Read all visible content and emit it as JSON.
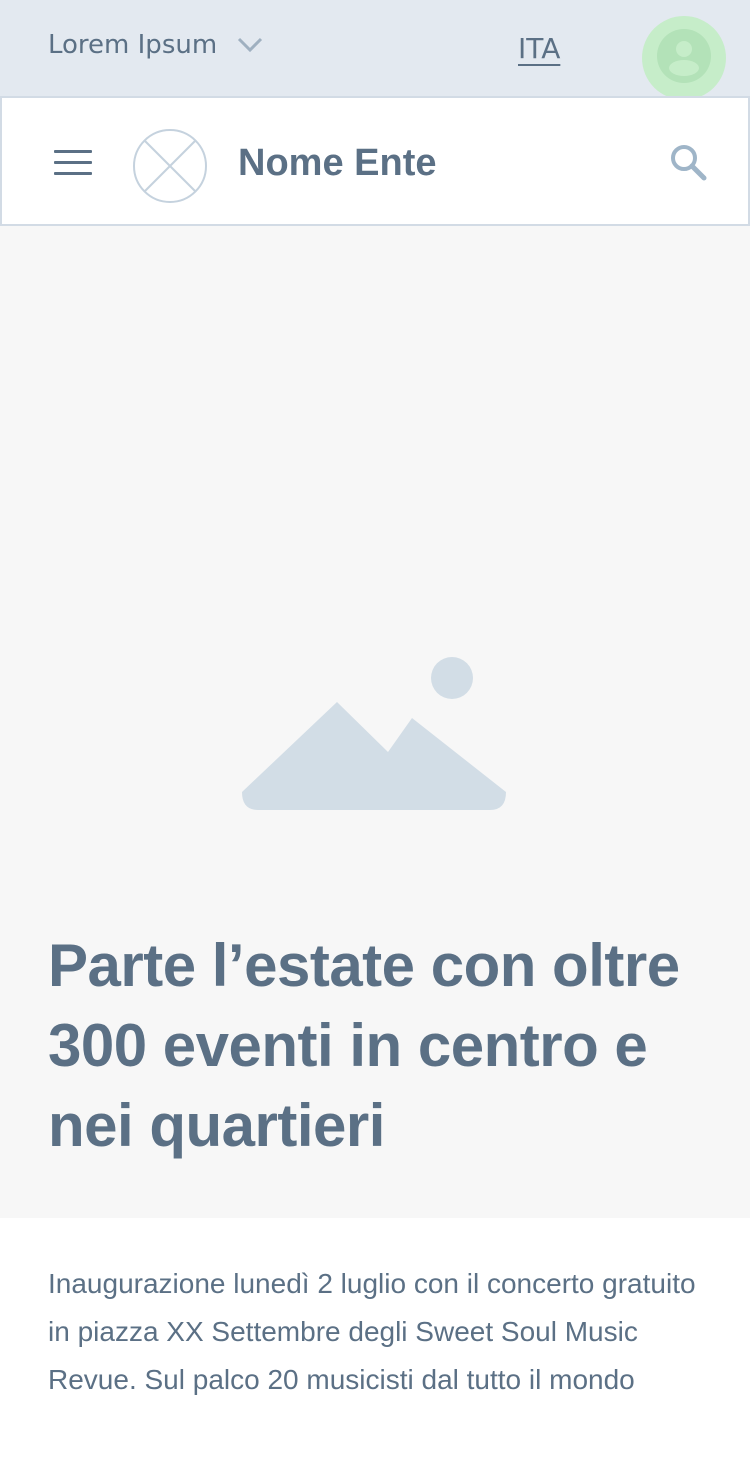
{
  "topbar": {
    "entity_label": "Lorem Ipsum",
    "chevron_icon": "chevron-down-icon",
    "language": "ITA",
    "avatar_icon": "user-icon",
    "avatar_bg": "#c6edc9"
  },
  "header": {
    "menu_icon": "hamburger-menu-icon",
    "logo_icon": "logo-placeholder-icon",
    "brand_name": "Nome Ente",
    "search_icon": "search-icon"
  },
  "hero": {
    "image_icon": "image-placeholder-icon",
    "title": "Parte l’estate con oltre 300 eventi in centro e nei quartieri"
  },
  "article": {
    "description": "Inaugurazione lunedì 2 luglio con il concerto gratuito in piazza XX Settembre degli Sweet Soul Music Revue. Sul palco 20 musicisti dal tutto il mondo"
  },
  "colors": {
    "primary_text": "#5b7085",
    "topbar_bg": "#e3e9f0",
    "hero_bg": "#f7f7f7",
    "placeholder": "#d2dde6"
  }
}
